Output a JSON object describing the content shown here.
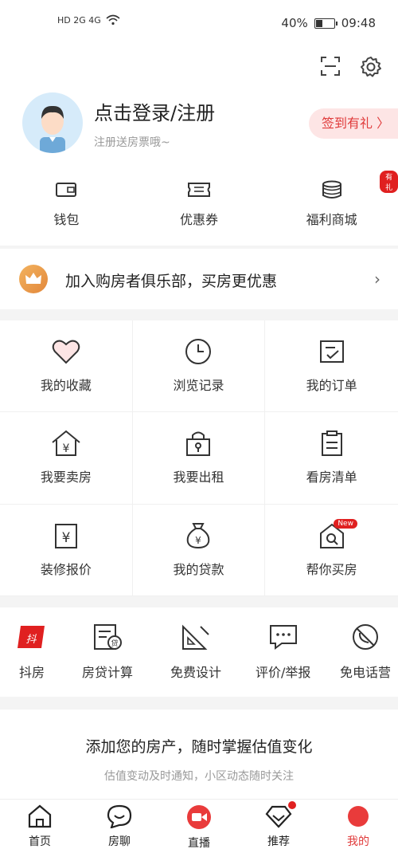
{
  "status_bar": {
    "network": "HD 2G 4G",
    "battery": "40%",
    "battery_level": 0.4,
    "time": "09:48"
  },
  "profile": {
    "login_title": "点击登录/注册",
    "login_subtitle": "注册送房票哦~",
    "signin_label": "签到有礼 〉"
  },
  "wallet_row": [
    {
      "label": "钱包",
      "icon": "wallet-icon"
    },
    {
      "label": "优惠券",
      "icon": "coupon-icon"
    },
    {
      "label": "福利商城",
      "icon": "coins-icon",
      "badge": "有礼"
    }
  ],
  "club": {
    "text": "加入购房者俱乐部，买房更优惠",
    "arrow": "›"
  },
  "grid": [
    {
      "label": "我的收藏",
      "icon": "heart-icon"
    },
    {
      "label": "浏览记录",
      "icon": "clock-icon"
    },
    {
      "label": "我的订单",
      "icon": "order-icon"
    },
    {
      "label": "我要卖房",
      "icon": "house-yen-icon"
    },
    {
      "label": "我要出租",
      "icon": "rent-lock-icon"
    },
    {
      "label": "看房清单",
      "icon": "clipboard-icon"
    },
    {
      "label": "装修报价",
      "icon": "quote-icon"
    },
    {
      "label": "我的贷款",
      "icon": "money-bag-icon"
    },
    {
      "label": "帮你买房",
      "icon": "search-house-icon",
      "badge": "New"
    }
  ],
  "tools": [
    {
      "label": "抖房",
      "icon": "doufang-logo-icon"
    },
    {
      "label": "房贷计算",
      "icon": "calculator-icon"
    },
    {
      "label": "免费设计",
      "icon": "ruler-icon"
    },
    {
      "label": "评价/举报",
      "icon": "chat-icon"
    },
    {
      "label": "免电话营",
      "icon": "no-phone-icon"
    }
  ],
  "property": {
    "title": "添加您的房产，随时掌握估值变化",
    "subtitle": "估值变动及时通知，小区动态随时关注"
  },
  "tabbar": [
    {
      "label": "首页",
      "icon": "home-icon"
    },
    {
      "label": "房聊",
      "icon": "chat-bubble-icon"
    },
    {
      "label": "直播",
      "icon": "live-camera-icon"
    },
    {
      "label": "推荐",
      "icon": "diamond-icon"
    },
    {
      "label": "我的",
      "icon": "profile-icon"
    }
  ],
  "colors": {
    "accent": "#e03a3a",
    "club_crown": "#e2873a",
    "background": "#f4f4f4"
  }
}
